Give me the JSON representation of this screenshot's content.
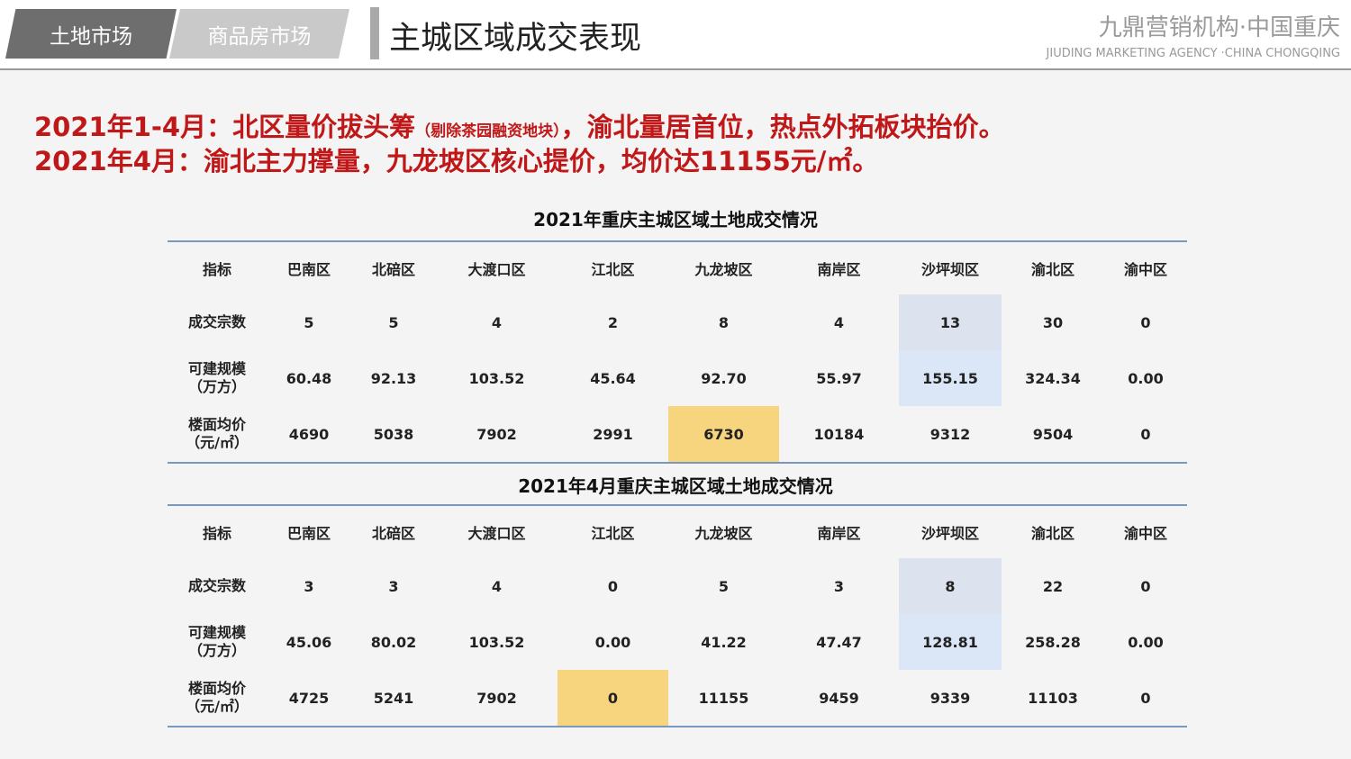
{
  "header": {
    "tabs": [
      {
        "label": "土地市场",
        "active": true
      },
      {
        "label": "商品房市场",
        "active": false
      }
    ],
    "title": "主城区域成交表现",
    "brand_cn": "九鼎营销机构·中国重庆",
    "brand_en": "JIUDING MARKETING AGENCY ·CHINA CHONGQING"
  },
  "headline": {
    "line1_main": "2021年1-4月：北区量价拔头筹",
    "line1_note": "（剔除茶园融资地块）",
    "line1_rest": "，渝北量居首位，热点外拓板块抬价。",
    "line2": "2021年4月：渝北主力撑量，九龙坡区核心提价，均价达11155元/㎡。"
  },
  "colors": {
    "headline": "#c01818",
    "rule": "#7a98bd",
    "highlight_gray": "#dde2ef",
    "highlight_blue": "#dbe6f6",
    "highlight_yellow": "#f6d57e"
  },
  "tables": [
    {
      "title": "2021年重庆主城区域土地成交情况",
      "headers": [
        "指标",
        "巴南区",
        "北碚区",
        "大渡口区",
        "江北区",
        "九龙坡区",
        "南岸区",
        "沙坪坝区",
        "渝北区",
        "渝中区"
      ],
      "rows": [
        {
          "label": "成交宗数",
          "values": [
            "5",
            "5",
            "4",
            "2",
            "8",
            "4",
            "13",
            "30",
            "0"
          ]
        },
        {
          "label": "可建规模\n（万方）",
          "values": [
            "60.48",
            "92.13",
            "103.52",
            "45.64",
            "92.70",
            "55.97",
            "155.15",
            "324.34",
            "0.00"
          ]
        },
        {
          "label": "楼面均价\n（元/㎡）",
          "values": [
            "4690",
            "5038",
            "7902",
            "2991",
            "6730",
            "10184",
            "9312",
            "9504",
            "0"
          ]
        }
      ]
    },
    {
      "title": "2021年4月重庆主城区域土地成交情况",
      "headers": [
        "指标",
        "巴南区",
        "北碚区",
        "大渡口区",
        "江北区",
        "九龙坡区",
        "南岸区",
        "沙坪坝区",
        "渝北区",
        "渝中区"
      ],
      "rows": [
        {
          "label": "成交宗数",
          "values": [
            "3",
            "3",
            "4",
            "0",
            "5",
            "3",
            "8",
            "22",
            "0"
          ]
        },
        {
          "label": "可建规模\n（万方）",
          "values": [
            "45.06",
            "80.02",
            "103.52",
            "0.00",
            "41.22",
            "47.47",
            "128.81",
            "258.28",
            "0.00"
          ]
        },
        {
          "label": "楼面均价\n（元/㎡）",
          "values": [
            "4725",
            "5241",
            "7902",
            "0",
            "11155",
            "9459",
            "9339",
            "11103",
            "0"
          ]
        }
      ]
    }
  ]
}
